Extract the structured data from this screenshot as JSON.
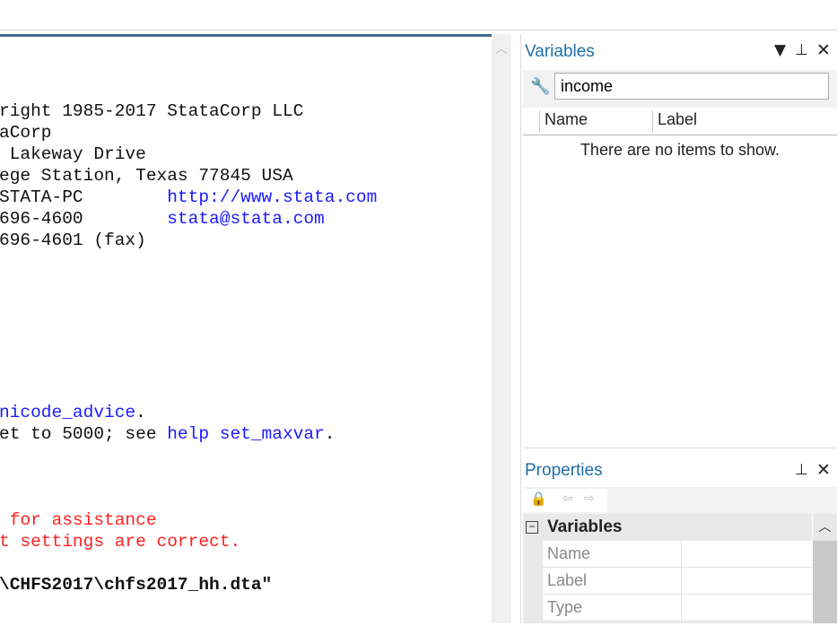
{
  "results": {
    "lines": [
      [
        {
          "t": "right 1985-2017 StataCorp LLC",
          "c": ""
        }
      ],
      [
        {
          "t": "aCorp",
          "c": ""
        }
      ],
      [
        {
          "t": " Lakeway Drive",
          "c": ""
        }
      ],
      [
        {
          "t": "ege Station, Texas 77845 USA",
          "c": ""
        }
      ],
      [
        {
          "t": "STATA-PC        ",
          "c": ""
        },
        {
          "t": "http://www.stata.com",
          "c": "blue"
        }
      ],
      [
        {
          "t": "696-4600        ",
          "c": ""
        },
        {
          "t": "stata@stata.com",
          "c": "blue"
        }
      ],
      [
        {
          "t": "696-4601 (fax)",
          "c": ""
        }
      ],
      [
        {
          "t": "nicode_advice",
          "c": "blue"
        },
        {
          "t": ".",
          "c": ""
        }
      ],
      [
        {
          "t": "et to 5000; see ",
          "c": ""
        },
        {
          "t": "help set_maxvar",
          "c": "blue"
        },
        {
          "t": ".",
          "c": ""
        }
      ],
      [
        {
          "t": " for assistance",
          "c": "red"
        }
      ],
      [
        {
          "t": "t settings are correct.",
          "c": "red"
        }
      ],
      [
        {
          "t": "\\CHFS2017\\chfs2017_hh.dta\"",
          "c": "bold"
        }
      ]
    ]
  },
  "variables": {
    "title": "Variables",
    "search_value": "income",
    "columns": [
      "Name",
      "Label"
    ],
    "empty_message": "There are no items to show."
  },
  "properties": {
    "title": "Properties",
    "section": "Variables",
    "rows": [
      "Name",
      "Label",
      "Type"
    ]
  }
}
